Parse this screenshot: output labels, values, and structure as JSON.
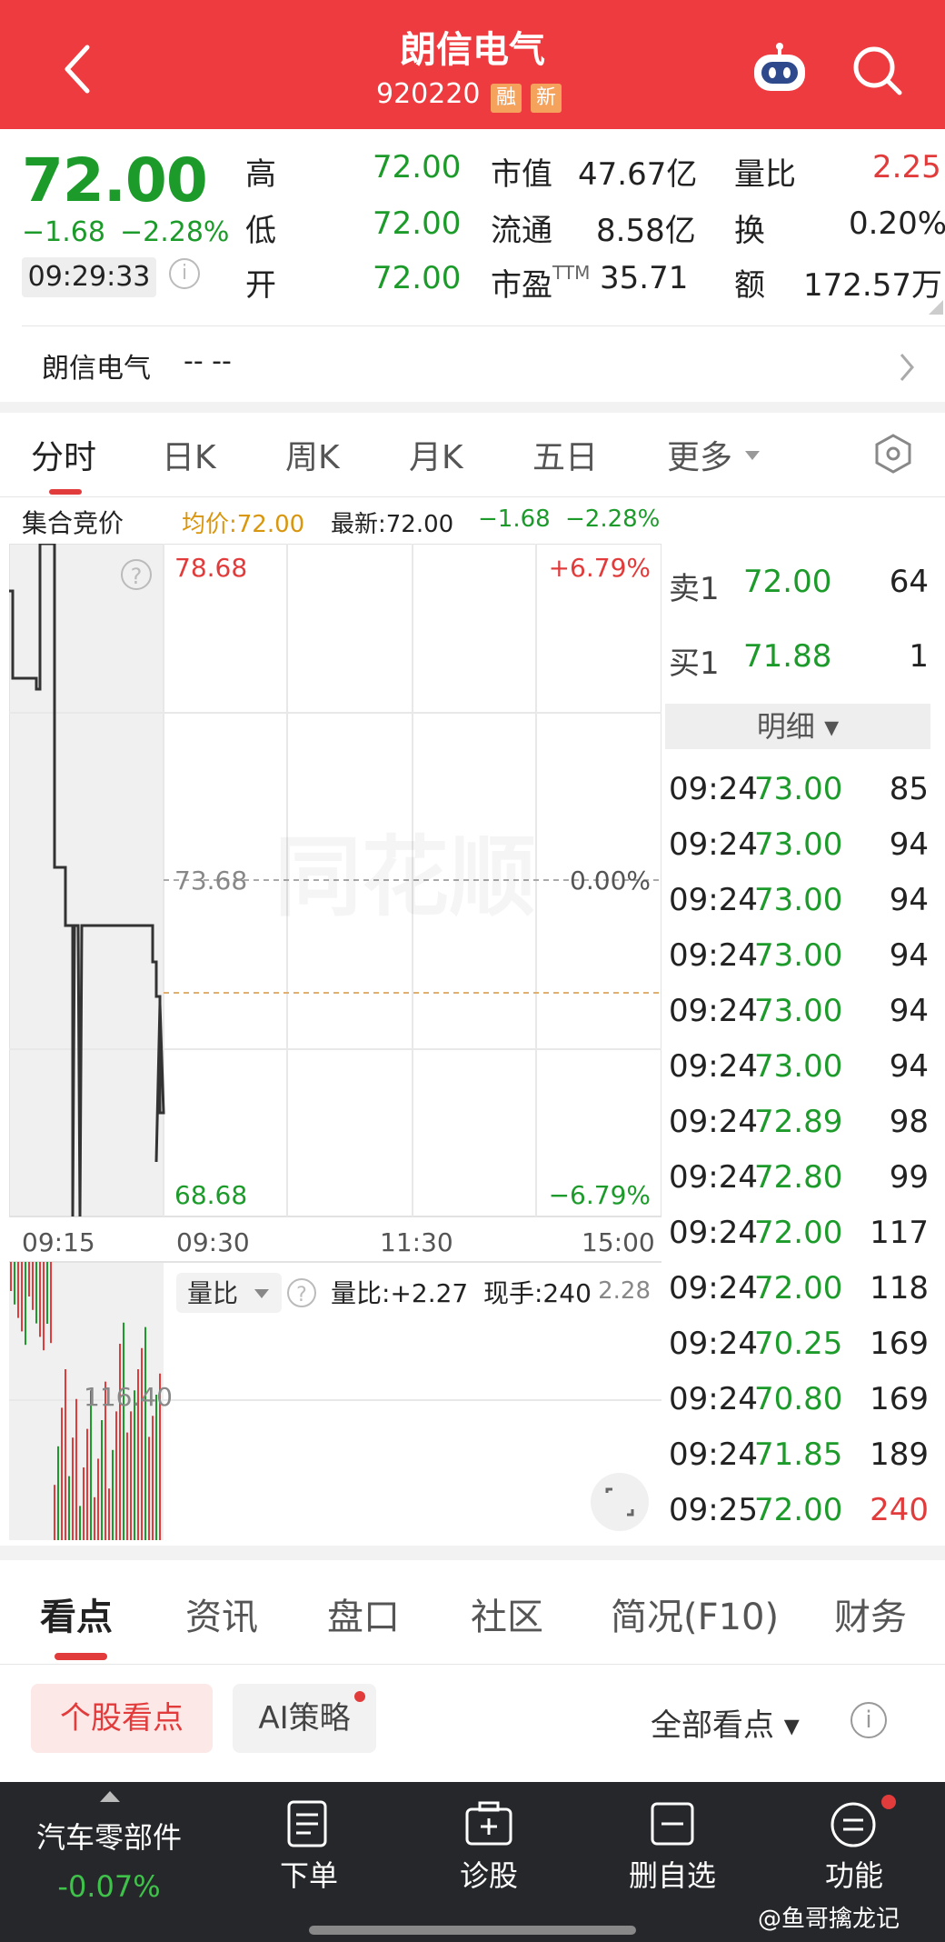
{
  "header": {
    "title": "朗信电气",
    "code": "920220",
    "tags": [
      "融",
      "新"
    ]
  },
  "quote": {
    "price": "72.00",
    "change": "−1.68",
    "change_pct": "−2.28%",
    "time": "09:29:33",
    "stats": [
      {
        "label": "高",
        "value": "72.00"
      },
      {
        "label": "低",
        "value": "72.00"
      },
      {
        "label": "开",
        "value": "72.00"
      },
      {
        "label": "市值",
        "value": "47.67亿"
      },
      {
        "label": "流通",
        "value": "8.58亿"
      },
      {
        "label": "市盈",
        "sup": "TTM",
        "value": "35.71"
      },
      {
        "label": "量比",
        "value": "2.25"
      },
      {
        "label": "换",
        "value": "0.20%"
      },
      {
        "label": "额",
        "value": "172.57万"
      }
    ]
  },
  "stock_row": {
    "name": "朗信电气",
    "dash": "-- --"
  },
  "chart_tabs": [
    "分时",
    "日K",
    "周K",
    "月K",
    "五日",
    "更多"
  ],
  "subheader": {
    "auction": "集合竞价",
    "avg": "均价:72.00",
    "latest": "最新:72.00",
    "chg": "−1.68",
    "pct": "−2.28%"
  },
  "chart_labels": {
    "top": "78.68",
    "top_pct": "+6.79%",
    "mid": "73.68",
    "mid_pct": "0.00%",
    "bottom": "68.68",
    "bottom_pct": "−6.79%",
    "times": [
      "09:15",
      "09:30",
      "11:30",
      "15:00"
    ],
    "vol_dropdown": "量比",
    "vol_ratio": "量比:+2.27",
    "vol_now": "现手:240",
    "vol_right": "2.28",
    "vol_left": "116.40",
    "watermark": "同花顺"
  },
  "order_book": [
    {
      "label": "卖1",
      "price": "72.00",
      "vol": "64"
    },
    {
      "label": "买1",
      "price": "71.88",
      "vol": "1"
    }
  ],
  "detail_label": "明细",
  "ticks": [
    {
      "t": "09:24",
      "p": "73.00",
      "v": "85"
    },
    {
      "t": "09:24",
      "p": "73.00",
      "v": "94"
    },
    {
      "t": "09:24",
      "p": "73.00",
      "v": "94"
    },
    {
      "t": "09:24",
      "p": "73.00",
      "v": "94"
    },
    {
      "t": "09:24",
      "p": "73.00",
      "v": "94"
    },
    {
      "t": "09:24",
      "p": "73.00",
      "v": "94"
    },
    {
      "t": "09:24",
      "p": "72.89",
      "v": "98"
    },
    {
      "t": "09:24",
      "p": "72.80",
      "v": "99"
    },
    {
      "t": "09:24",
      "p": "72.00",
      "v": "117"
    },
    {
      "t": "09:24",
      "p": "72.00",
      "v": "118"
    },
    {
      "t": "09:24",
      "p": "70.25",
      "v": "169"
    },
    {
      "t": "09:24",
      "p": "70.80",
      "v": "169"
    },
    {
      "t": "09:24",
      "p": "71.85",
      "v": "189"
    },
    {
      "t": "09:25",
      "p": "72.00",
      "v": "240"
    }
  ],
  "news_tabs": [
    "看点",
    "资讯",
    "盘口",
    "社区",
    "简况(F10)",
    "财务"
  ],
  "filters": {
    "pill1": "个股看点",
    "pill2": "AI策略",
    "all": "全部看点"
  },
  "bottom_nav": {
    "sector": "汽车零部件",
    "sector_pct": "-0.07%",
    "items": [
      "下单",
      "诊股",
      "删自选",
      "功能"
    ],
    "watermark": "@鱼哥擒龙记"
  }
}
